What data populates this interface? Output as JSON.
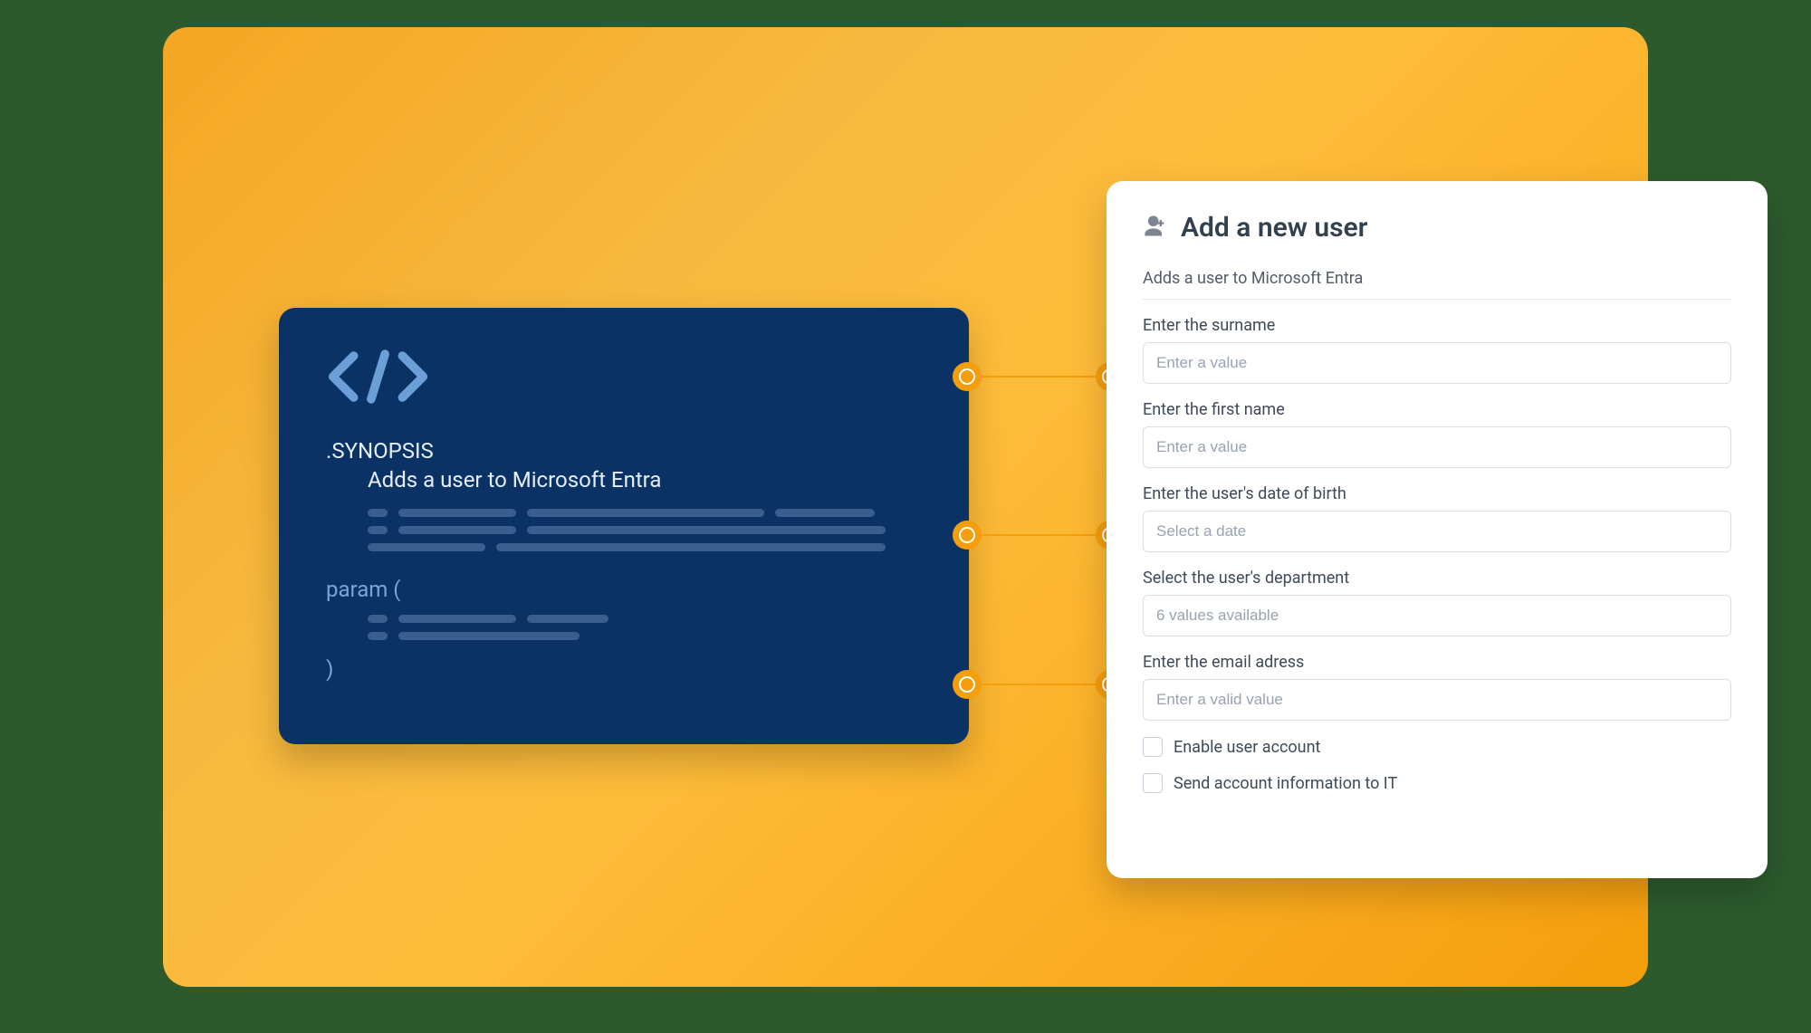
{
  "code": {
    "synopsis_label": ".SYNOPSIS",
    "synopsis_text": "Adds a user to Microsoft Entra",
    "param_open": "param (",
    "param_close": ")"
  },
  "form": {
    "title": "Add a new user",
    "subtitle": "Adds a user to Microsoft Entra",
    "fields": {
      "surname": {
        "label": "Enter the surname",
        "placeholder": "Enter a value"
      },
      "firstname": {
        "label": "Enter the first name",
        "placeholder": "Enter a value"
      },
      "dob": {
        "label": "Enter the user's date of birth",
        "placeholder": "Select a date"
      },
      "department": {
        "label": "Select the user's department",
        "placeholder": "6 values available"
      },
      "email": {
        "label": "Enter the email adress",
        "placeholder": "Enter a valid value"
      }
    },
    "checks": {
      "enable": "Enable user account",
      "sendit": "Send account information to IT"
    }
  }
}
